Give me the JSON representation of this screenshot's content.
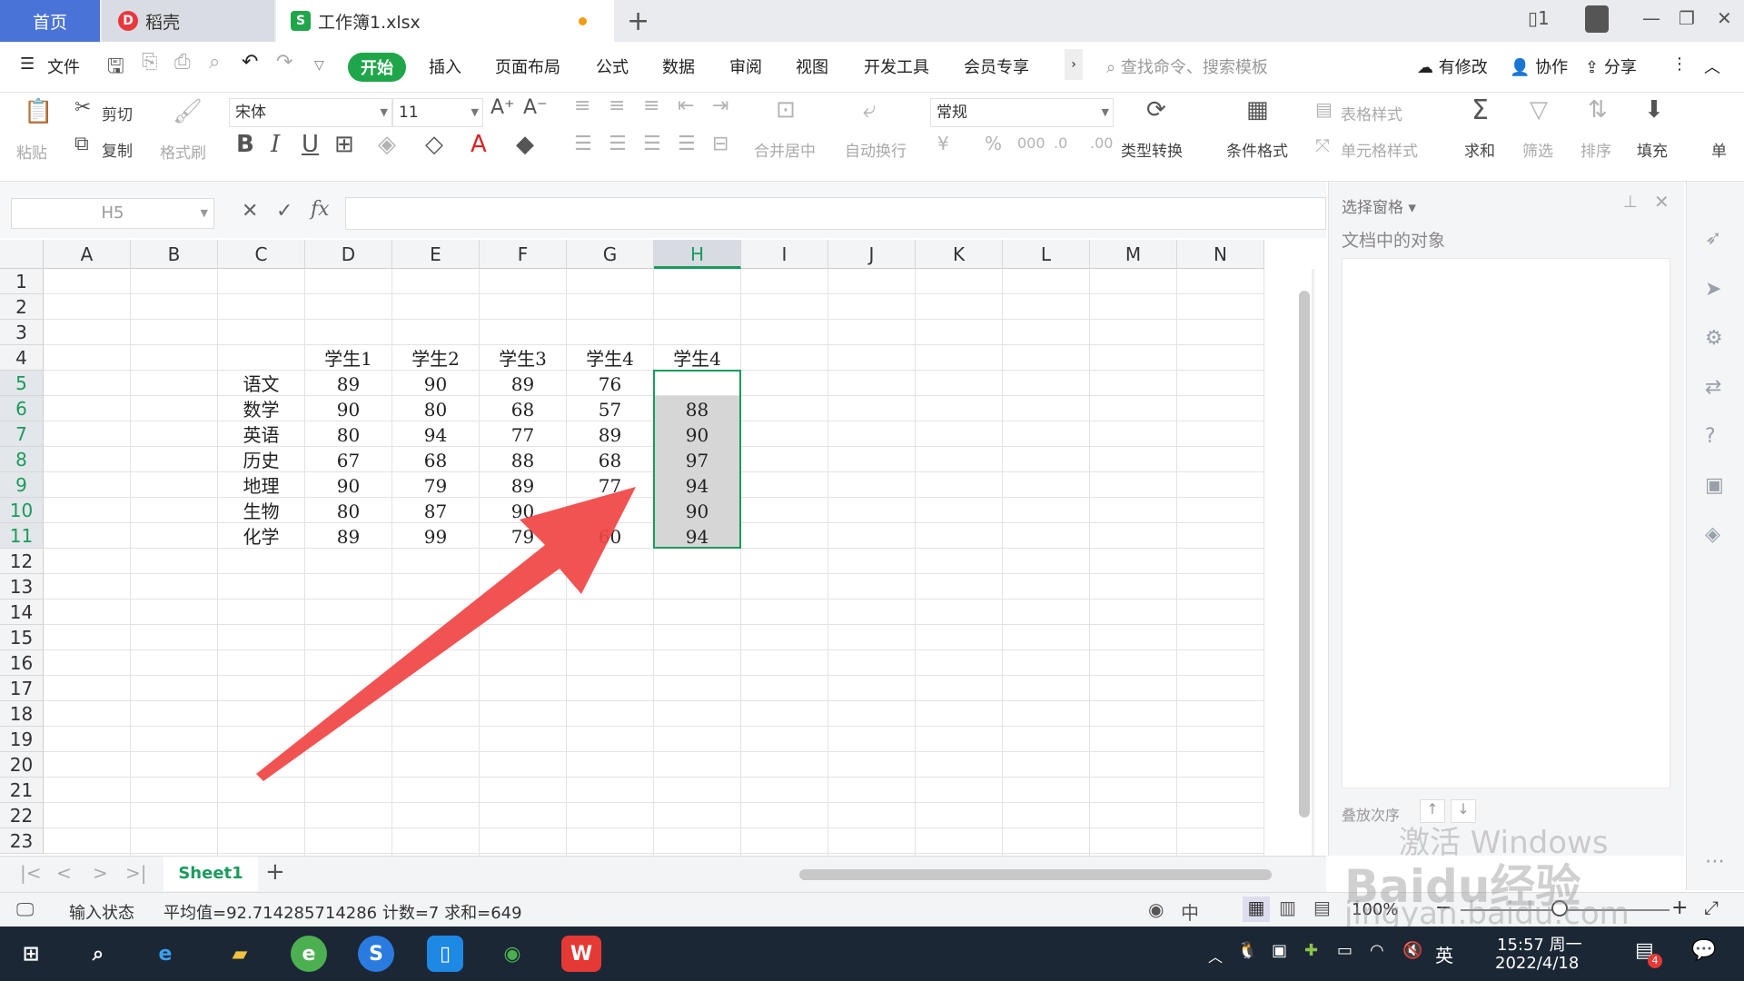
{
  "tabs": {
    "home": "首页",
    "daoke": "稻壳",
    "book": "工作簿1.xlsx"
  },
  "menu": [
    "文件",
    "开始",
    "插入",
    "页面布局",
    "公式",
    "数据",
    "审阅",
    "视图",
    "开发工具",
    "会员专享"
  ],
  "search_placeholder": "查找命令、搜索模板",
  "right_actions": {
    "modified": "有修改",
    "collab": "协作",
    "share": "分享"
  },
  "toolbar": {
    "paste": "粘贴",
    "cut": "剪切",
    "copy": "复制",
    "format_painter": "格式刷",
    "font": "宋体",
    "size": "11",
    "merge": "合并居中",
    "wrap": "自动换行",
    "number_format": "常规",
    "type_convert": "类型转换",
    "cond_format": "条件格式",
    "table_style": "表格样式",
    "cell_style": "单元格样式",
    "sum": "求和",
    "filter": "筛选",
    "sort": "排序",
    "fill": "填充",
    "cell_more": "单"
  },
  "formula": {
    "cell_ref": "H5",
    "fx": "fx",
    "value": ""
  },
  "grid": {
    "columns": [
      "A",
      "B",
      "C",
      "D",
      "E",
      "F",
      "G",
      "H",
      "I",
      "J",
      "K",
      "L",
      "M",
      "N"
    ],
    "rows": [
      "1",
      "2",
      "3",
      "4",
      "5",
      "6",
      "7",
      "8",
      "9",
      "10",
      "11",
      "12",
      "13",
      "14",
      "15",
      "16",
      "17",
      "18",
      "19",
      "20",
      "21",
      "22",
      "23"
    ],
    "headers": [
      "学生1",
      "学生2",
      "学生3",
      "学生4",
      "学生4"
    ],
    "data": [
      {
        "subject": "语文",
        "values": [
          "89",
          "90",
          "89",
          "76",
          ""
        ]
      },
      {
        "subject": "数学",
        "values": [
          "90",
          "80",
          "68",
          "57",
          "88"
        ]
      },
      {
        "subject": "英语",
        "values": [
          "80",
          "94",
          "77",
          "89",
          "90"
        ]
      },
      {
        "subject": "历史",
        "values": [
          "67",
          "68",
          "88",
          "68",
          "97"
        ]
      },
      {
        "subject": "地理",
        "values": [
          "90",
          "79",
          "89",
          "77",
          "94"
        ]
      },
      {
        "subject": "生物",
        "values": [
          "80",
          "87",
          "90",
          "",
          "90"
        ]
      },
      {
        "subject": "化学",
        "values": [
          "89",
          "99",
          "79",
          "60",
          "94"
        ]
      }
    ]
  },
  "pane": {
    "title": "选择窗格",
    "objects": "文档中的对象",
    "stack_order": "叠放次序"
  },
  "sheet": {
    "name": "Sheet1"
  },
  "status": {
    "mode": "输入状态",
    "summary": "平均值=92.714285714286 计数=7 求和=649",
    "zoom": "100%"
  },
  "taskbar": {
    "time": "15:57 周一",
    "date": "2022/4/18",
    "ime": "英",
    "notif": "4"
  },
  "watermark": {
    "activate": "激活 Windows",
    "baidu": "Baidu经验",
    "site": "jingyan.baidu.com"
  },
  "colors": {
    "accent": "#1fa64a",
    "select": "#1a9b5c",
    "home_tab": "#4a73d8",
    "arrow": "#f04444"
  }
}
